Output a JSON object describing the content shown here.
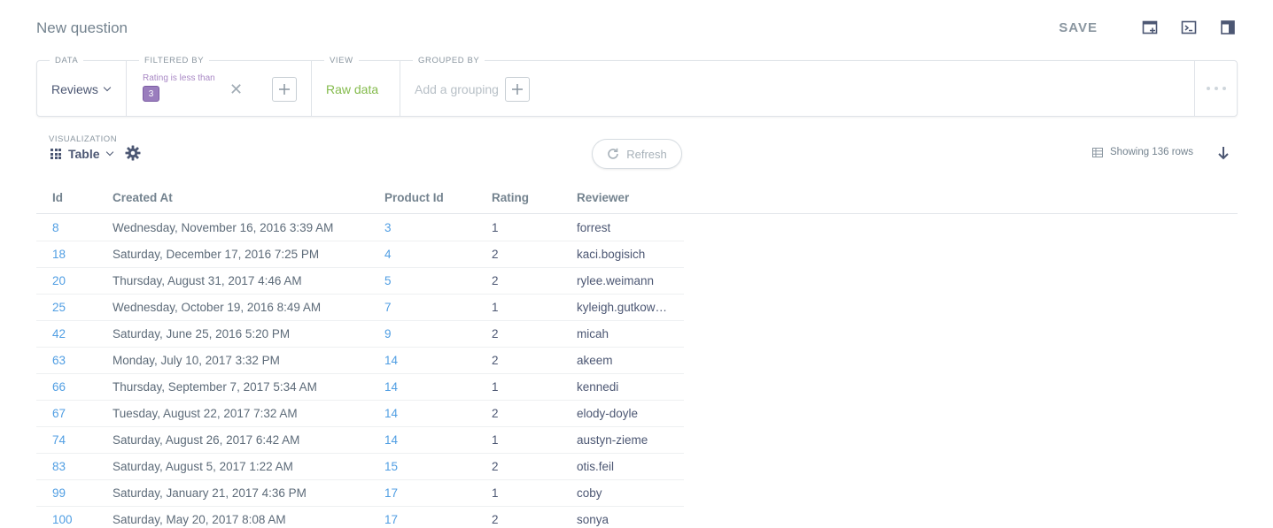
{
  "header": {
    "title": "New question",
    "save_label": "SAVE"
  },
  "query_builder": {
    "data_label": "DATA",
    "data_value": "Reviews",
    "filter_label": "FILTERED BY",
    "filter_text": "Rating is less than",
    "filter_value": "3",
    "view_label": "VIEW",
    "view_value": "Raw data",
    "group_label": "GROUPED BY",
    "group_placeholder": "Add a grouping"
  },
  "visualization": {
    "label": "VISUALIZATION",
    "type": "Table",
    "refresh_label": "Refresh",
    "rows_text": "Showing 136 rows"
  },
  "colors": {
    "link": "#509ee3",
    "filter": "#9a7dbd",
    "view": "#84bb4c"
  },
  "table": {
    "columns": [
      "Id",
      "Created At",
      "Product Id",
      "Rating",
      "Reviewer"
    ],
    "rows": [
      [
        "8",
        "Wednesday, November 16, 2016 3:39 AM",
        "3",
        "1",
        "forrest"
      ],
      [
        "18",
        "Saturday, December 17, 2016 7:25 PM",
        "4",
        "2",
        "kaci.bogisich"
      ],
      [
        "20",
        "Thursday, August 31, 2017 4:46 AM",
        "5",
        "2",
        "rylee.weimann"
      ],
      [
        "25",
        "Wednesday, October 19, 2016 8:49 AM",
        "7",
        "1",
        "kyleigh.gutkow…"
      ],
      [
        "42",
        "Saturday, June 25, 2016 5:20 PM",
        "9",
        "2",
        "micah"
      ],
      [
        "63",
        "Monday, July 10, 2017 3:32 PM",
        "14",
        "2",
        "akeem"
      ],
      [
        "66",
        "Thursday, September 7, 2017 5:34 AM",
        "14",
        "1",
        "kennedi"
      ],
      [
        "67",
        "Tuesday, August 22, 2017 7:32 AM",
        "14",
        "2",
        "elody-doyle"
      ],
      [
        "74",
        "Saturday, August 26, 2017 6:42 AM",
        "14",
        "1",
        "austyn-zieme"
      ],
      [
        "83",
        "Saturday, August 5, 2017 1:22 AM",
        "15",
        "2",
        "otis.feil"
      ],
      [
        "99",
        "Saturday, January 21, 2017 4:36 PM",
        "17",
        "1",
        "coby"
      ],
      [
        "100",
        "Saturday, May 20, 2017 8:08 AM",
        "17",
        "2",
        "sonya"
      ]
    ]
  }
}
